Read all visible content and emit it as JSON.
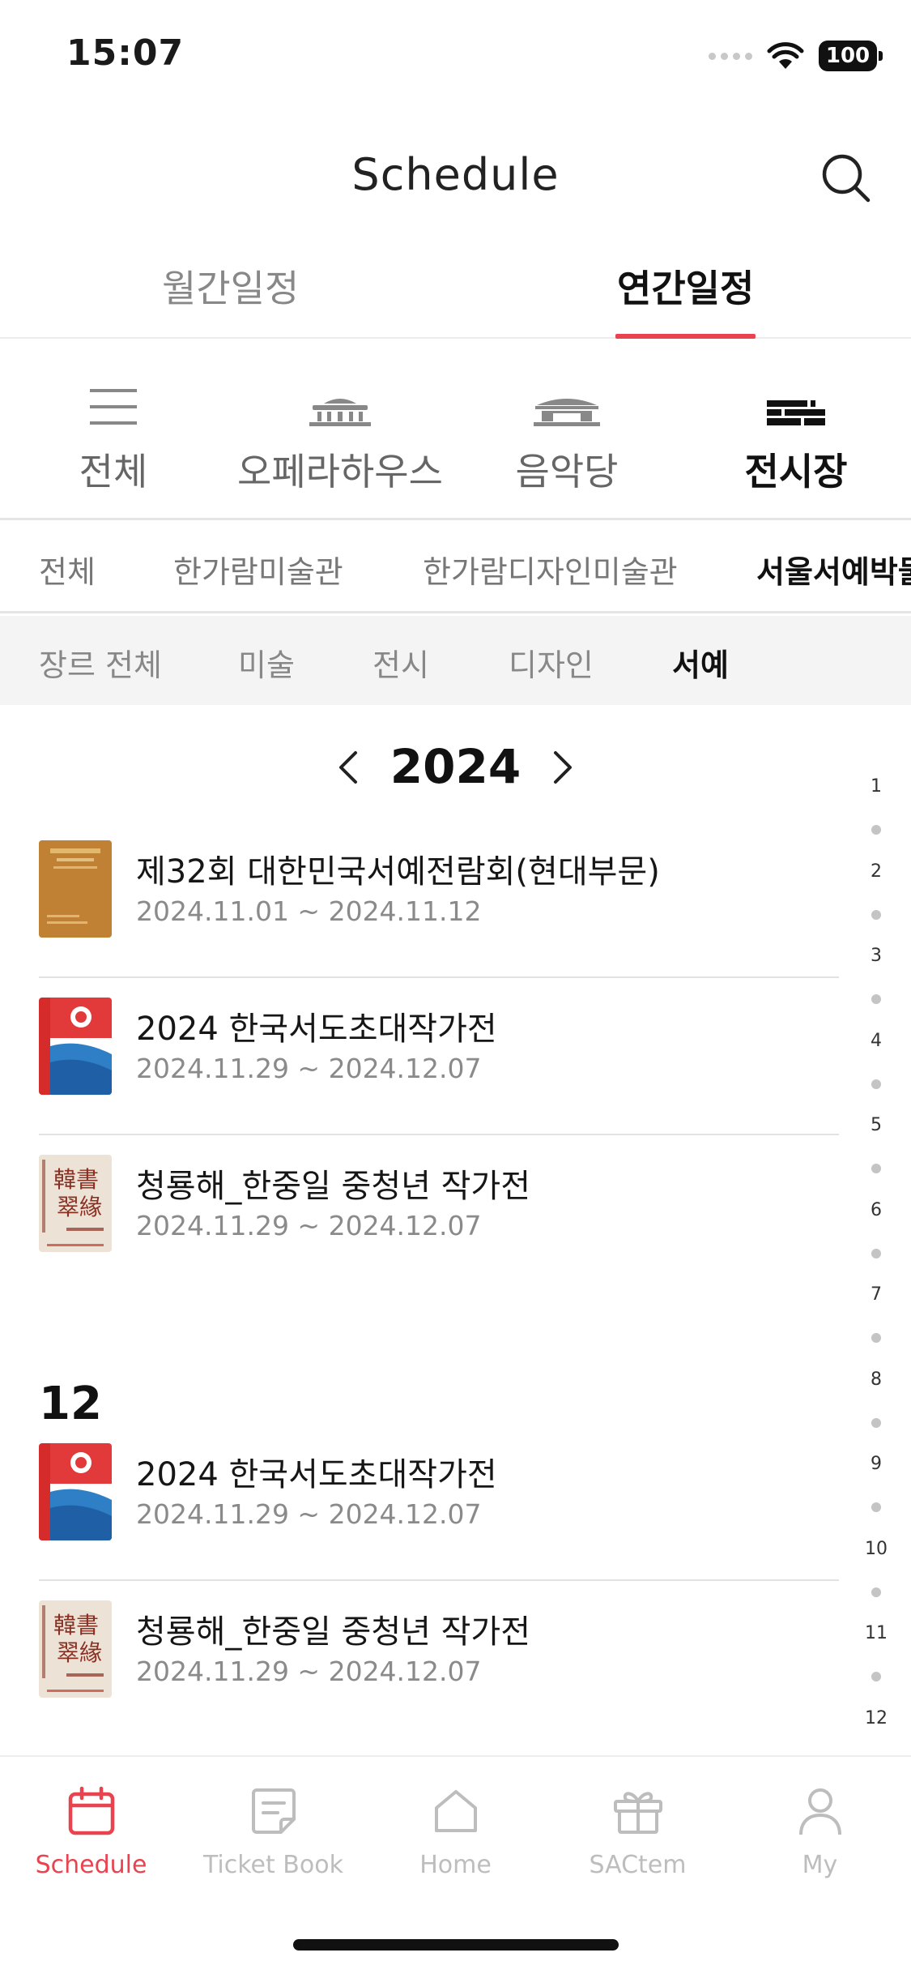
{
  "status_bar": {
    "time": "15:07",
    "battery": "100"
  },
  "header": {
    "title": "Schedule",
    "search_icon": "search-icon"
  },
  "top_tabs": [
    {
      "label": "월간일정",
      "active": false
    },
    {
      "label": "연간일정",
      "active": true
    }
  ],
  "venues": [
    {
      "label": "전체",
      "icon": "menu-icon",
      "active": false
    },
    {
      "label": "오페라하우스",
      "icon": "opera-house-icon",
      "active": false
    },
    {
      "label": "음악당",
      "icon": "concert-hall-icon",
      "active": false
    },
    {
      "label": "전시장",
      "icon": "exhibition-hall-icon",
      "active": true
    }
  ],
  "subvenues": [
    {
      "label": "전체",
      "active": false
    },
    {
      "label": "한가람미술관",
      "active": false
    },
    {
      "label": "한가람디자인미술관",
      "active": false
    },
    {
      "label": "서울서예박물관",
      "active": true
    }
  ],
  "genres": [
    {
      "label": "장르 전체",
      "active": false
    },
    {
      "label": "미술",
      "active": false
    },
    {
      "label": "전시",
      "active": false
    },
    {
      "label": "디자인",
      "active": false
    },
    {
      "label": "서예",
      "active": true
    }
  ],
  "year_nav": {
    "year": "2024"
  },
  "events": [
    {
      "title": "제32회 대한민국서예전람회(현대부문)",
      "date": "2024.11.01 ~ 2024.11.12"
    },
    {
      "title": "2024 한국서도초대작가전",
      "date": "2024.11.29 ~ 2024.12.07"
    },
    {
      "title": "청룡해_한중일 중청년 작가전",
      "date": "2024.11.29 ~ 2024.12.07"
    }
  ],
  "month_section": {
    "month": "12",
    "events": [
      {
        "title": "2024 한국서도초대작가전",
        "date": "2024.11.29 ~ 2024.12.07"
      },
      {
        "title": "청룡해_한중일 중청년 작가전",
        "date": "2024.11.29 ~ 2024.12.07"
      }
    ]
  },
  "month_index": [
    "1",
    "2",
    "3",
    "4",
    "5",
    "6",
    "7",
    "8",
    "9",
    "10",
    "11",
    "12"
  ],
  "bottom_nav": [
    {
      "label": "Schedule",
      "icon": "calendar-icon",
      "active": true
    },
    {
      "label": "Ticket Book",
      "icon": "ticket-book-icon",
      "active": false
    },
    {
      "label": "Home",
      "icon": "home-icon",
      "active": false
    },
    {
      "label": "SACtem",
      "icon": "gift-icon",
      "active": false
    },
    {
      "label": "My",
      "icon": "user-icon",
      "active": false
    }
  ],
  "colors": {
    "accent": "#e8434f",
    "inactive": "#888888",
    "divider": "#e5e5e5"
  }
}
